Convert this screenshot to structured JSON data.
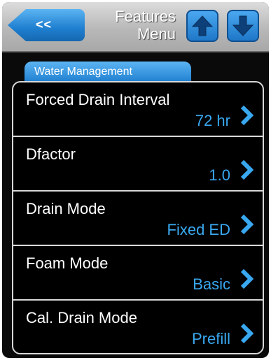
{
  "header": {
    "back_label": "<<",
    "title_line1": "Features",
    "title_line2": "Menu"
  },
  "tab": {
    "label": "Water Management"
  },
  "items": [
    {
      "label": "Forced Drain Interval",
      "value": "72 hr"
    },
    {
      "label": "Dfactor",
      "value": "1.0"
    },
    {
      "label": "Drain Mode",
      "value": "Fixed ED"
    },
    {
      "label": "Foam Mode",
      "value": "Basic"
    },
    {
      "label": "Cal. Drain Mode",
      "value": "Prefill"
    }
  ],
  "icons": {
    "up": "arrow-up-icon",
    "down": "arrow-down-icon",
    "chevron": "chevron-right-icon"
  },
  "colors": {
    "accent_blue": "#1f7fd0",
    "value_text": "#39a8f0",
    "background": "#000000"
  }
}
